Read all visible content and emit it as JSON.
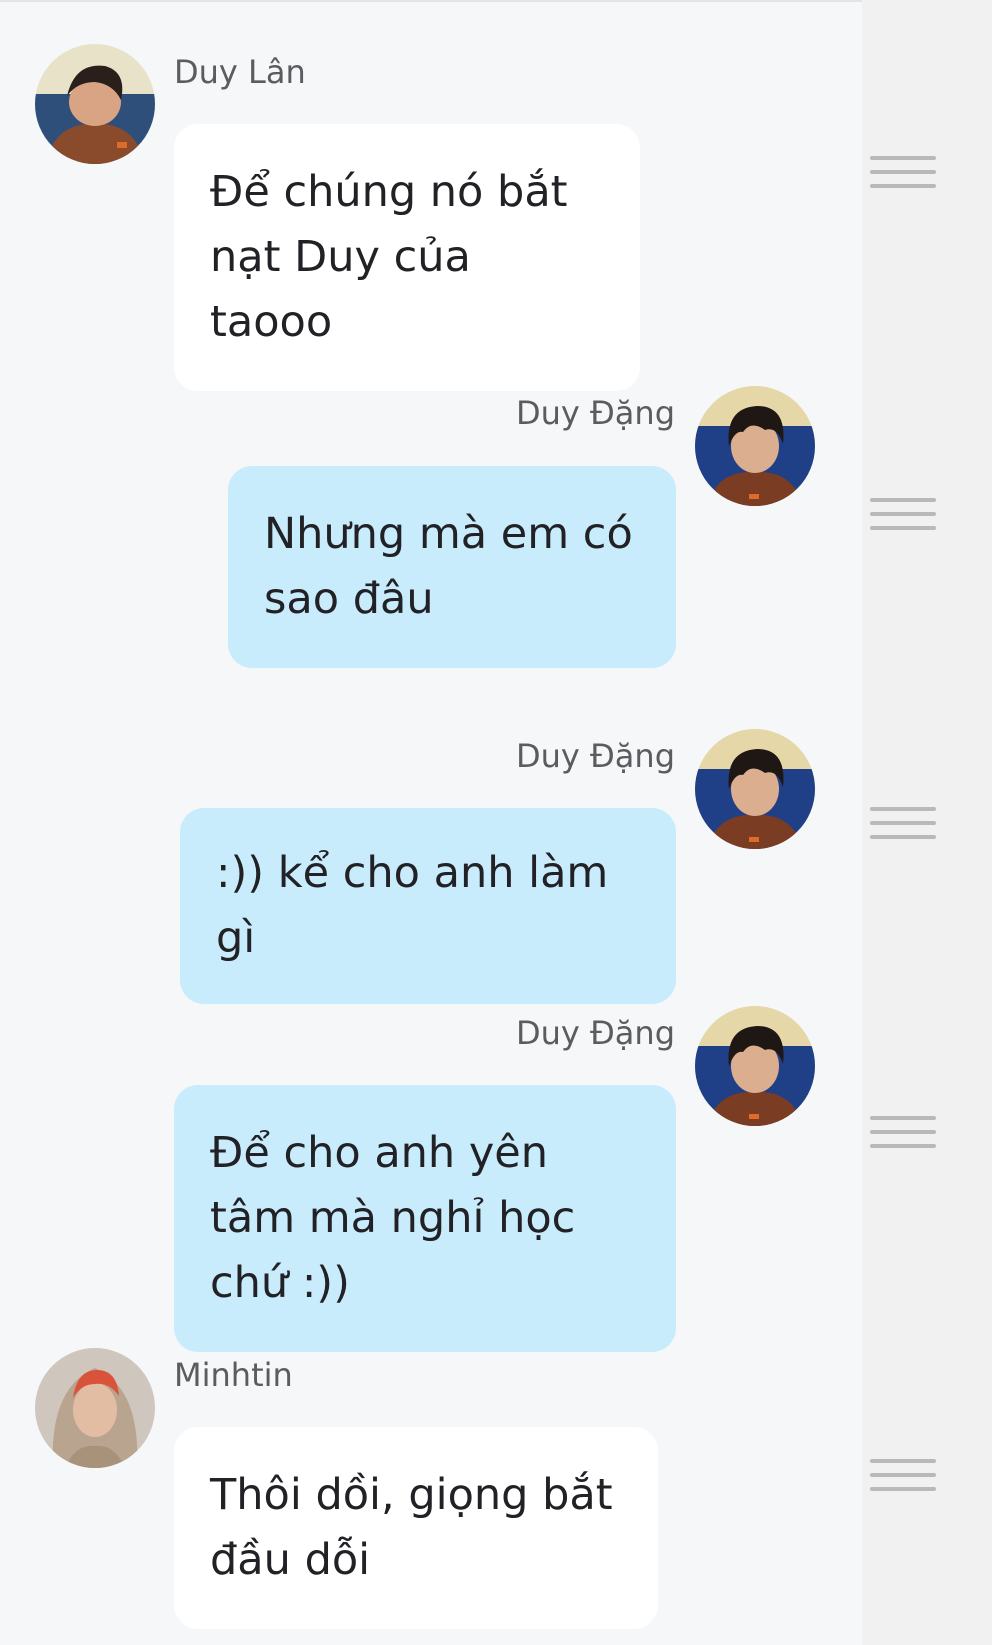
{
  "messages": [
    {
      "sender": "Duy Lân",
      "text": "Để chúng nó bắt nạt Duy của taooo",
      "side": "left",
      "bubble_color": "#ffffff"
    },
    {
      "sender": "Duy Đặng",
      "text": "Nhưng mà em có sao đâu",
      "side": "right",
      "bubble_color": "#c9ecfd"
    },
    {
      "sender": "Duy Đặng",
      "text": ":)) kể cho anh làm gì",
      "side": "right",
      "bubble_color": "#c9ecfd"
    },
    {
      "sender": "Duy Đặng",
      "text": "Để cho anh yên tâm mà nghỉ học chứ :))",
      "side": "right",
      "bubble_color": "#c9ecfd"
    },
    {
      "sender": "Minhtin",
      "text": "Thôi dồi, giọng bắt đầu dỗi",
      "side": "left",
      "bubble_color": "#ffffff"
    }
  ],
  "icons": {
    "avatar": "avatar-photo",
    "drag_handle": "drag-handle-icon"
  },
  "colors": {
    "background": "#f5f7f9",
    "incoming_bubble": "#ffffff",
    "outgoing_bubble": "#c9ecfd",
    "side_panel": "#f1f1f2"
  }
}
